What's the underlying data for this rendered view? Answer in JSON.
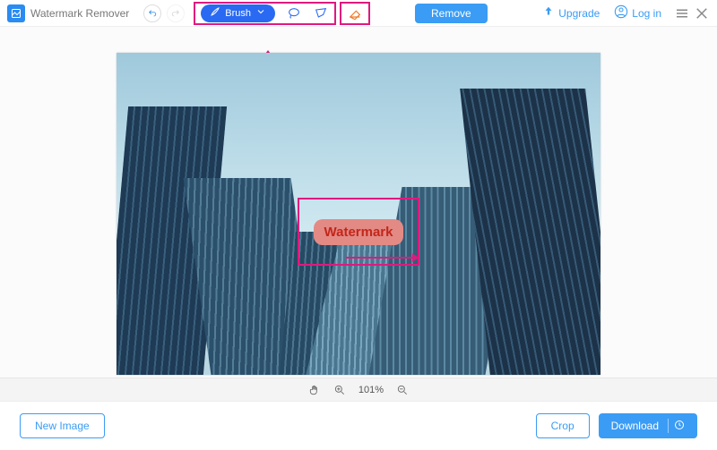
{
  "app": {
    "title": "Watermark Remover"
  },
  "toolbar": {
    "brush_label": "Brush",
    "remove_label": "Remove",
    "upgrade_label": "Upgrade",
    "login_label": "Log in"
  },
  "watermark": {
    "text": "Watermark"
  },
  "zoom": {
    "level": "101%"
  },
  "footer": {
    "new_image_label": "New Image",
    "crop_label": "Crop",
    "download_label": "Download"
  }
}
